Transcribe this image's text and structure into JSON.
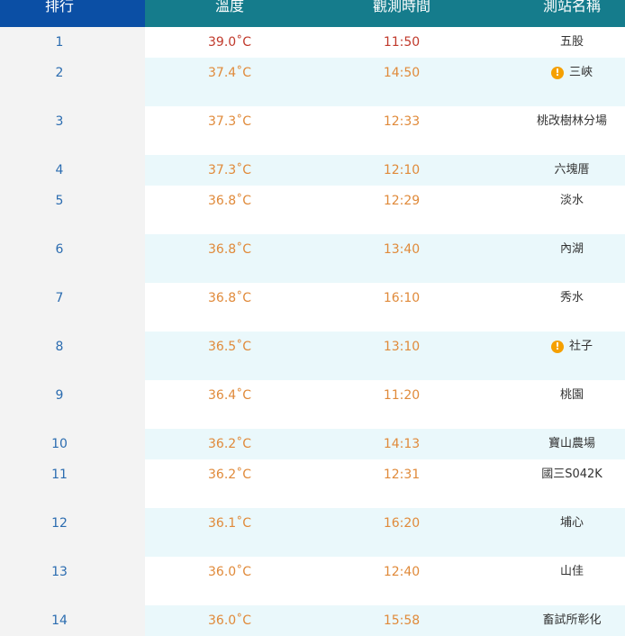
{
  "header": {
    "rank": "排行",
    "temp": "溫度",
    "time": "觀測時間",
    "station": "測站名稱"
  },
  "rows": [
    {
      "rank": "1",
      "temp": "39.0˚C",
      "time": "11:50",
      "station": "五股",
      "warning": false,
      "hot": true
    },
    {
      "rank": "2",
      "temp": "37.4˚C",
      "time": "14:50",
      "station": "三峽",
      "warning": true,
      "hot": false
    },
    {
      "rank": "3",
      "temp": "37.3˚C",
      "time": "12:33",
      "station": "桃改樹林分場",
      "warning": false,
      "hot": false
    },
    {
      "rank": "4",
      "temp": "37.3˚C",
      "time": "12:10",
      "station": "六塊厝",
      "warning": false,
      "hot": false
    },
    {
      "rank": "5",
      "temp": "36.8˚C",
      "time": "12:29",
      "station": "淡水",
      "warning": false,
      "hot": false
    },
    {
      "rank": "6",
      "temp": "36.8˚C",
      "time": "13:40",
      "station": "內湖",
      "warning": false,
      "hot": false
    },
    {
      "rank": "7",
      "temp": "36.8˚C",
      "time": "16:10",
      "station": "秀水",
      "warning": false,
      "hot": false
    },
    {
      "rank": "8",
      "temp": "36.5˚C",
      "time": "13:10",
      "station": "社子",
      "warning": true,
      "hot": false
    },
    {
      "rank": "9",
      "temp": "36.4˚C",
      "time": "11:20",
      "station": "桃園",
      "warning": false,
      "hot": false
    },
    {
      "rank": "10",
      "temp": "36.2˚C",
      "time": "14:13",
      "station": "寶山農場",
      "warning": false,
      "hot": false
    },
    {
      "rank": "11",
      "temp": "36.2˚C",
      "time": "12:31",
      "station": "國三S042K",
      "warning": false,
      "hot": false
    },
    {
      "rank": "12",
      "temp": "36.1˚C",
      "time": "16:20",
      "station": "埔心",
      "warning": false,
      "hot": false
    },
    {
      "rank": "13",
      "temp": "36.0˚C",
      "time": "12:40",
      "station": "山佳",
      "warning": false,
      "hot": false
    },
    {
      "rank": "14",
      "temp": "36.0˚C",
      "time": "15:58",
      "station": "畜試所彰化",
      "warning": false,
      "hot": false
    }
  ],
  "icons": {
    "warning": "warning-icon"
  },
  "colors": {
    "rank_header_bg": "#0b4fa5",
    "header_bg": "#157c8c",
    "alt_row_bg": "#eaf8fb",
    "value_text": "#e08a3a",
    "top_value_text": "#c0392b",
    "warning_icon": "#f5a000"
  }
}
